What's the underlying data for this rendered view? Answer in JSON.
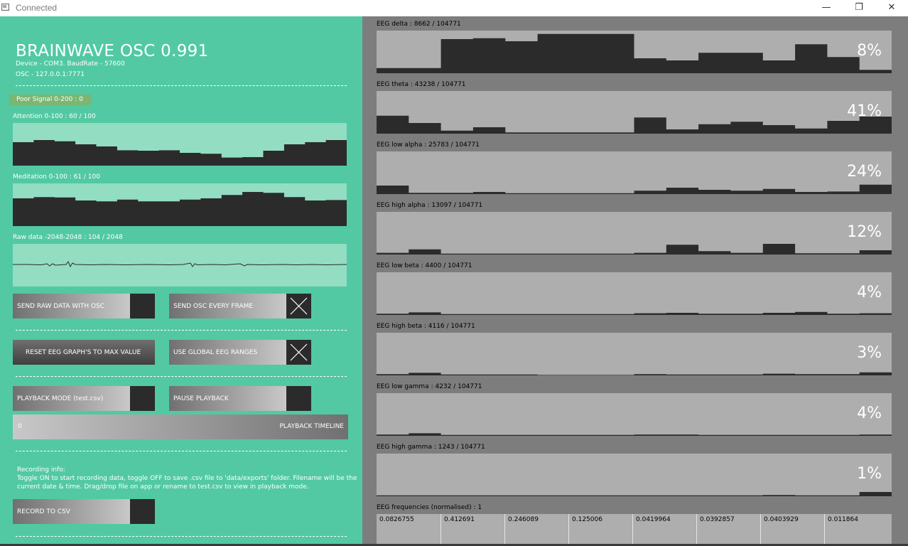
{
  "window": {
    "title": "Connected",
    "minimize": "—",
    "maximize": "❐",
    "close": "✕"
  },
  "app": {
    "title": "BRAINWAVE OSC 0.991",
    "device": "Device - COM3. BaudRate - 57600",
    "osc": "OSC - 127.0.0.1:7771"
  },
  "signal": "Poor Signal 0-200 : 0",
  "graphs": [
    {
      "label": "Attention 0-100 : 60 / 100",
      "values": [
        55,
        60,
        57,
        50,
        45,
        36,
        35,
        36,
        30,
        28,
        19,
        20,
        35,
        50,
        55,
        60
      ]
    },
    {
      "label": "Meditation 0-100 : 61 / 100",
      "values": [
        65,
        68,
        67,
        60,
        58,
        62,
        58,
        58,
        62,
        65,
        73,
        80,
        78,
        68,
        60,
        61
      ]
    },
    {
      "label": "Raw data -2048-2048 : 104 / 2048"
    }
  ],
  "buttons": {
    "send_raw": "SEND RAW DATA WITH OSC",
    "send_every_frame": "SEND OSC EVERY FRAME",
    "reset_eeg": "RESET EEG GRAPH'S TO MAX VALUE",
    "global_ranges": "USE GLOBAL EEG RANGES",
    "playback_mode": "PLAYBACK MODE (test.csv)",
    "pause_playback": "PAUSE PLAYBACK",
    "record_csv": "RECORD TO CSV"
  },
  "toggles": {
    "send_raw": false,
    "send_every_frame": true,
    "global_ranges": true,
    "playback_mode": false,
    "pause_playback": false,
    "record_csv": false
  },
  "timeline": {
    "value": "0",
    "label": "PLAYBACK TIMELINE"
  },
  "recording": {
    "title": "Recording info:",
    "line1": "Toggle ON to start recording data, toggle OFF to save .csv file to 'data/exports' folder. Filename will be the",
    "line2": "current date & time. Drag/drop file on app or rename to test.csv to view in playback mode."
  },
  "eeg": [
    {
      "label": "EEG delta : 8662 / 104771",
      "percent": "8%",
      "values": [
        12,
        12,
        80,
        82,
        75,
        92,
        92,
        92,
        35,
        30,
        48,
        48,
        30,
        68,
        38,
        8
      ]
    },
    {
      "label": "EEG theta : 43238 / 104771",
      "percent": "41%",
      "values": [
        42,
        25,
        7,
        15,
        3,
        3,
        3,
        3,
        38,
        10,
        22,
        28,
        20,
        12,
        30,
        40
      ]
    },
    {
      "label": "EEG low alpha : 25783 / 104771",
      "percent": "24%",
      "values": [
        20,
        3,
        3,
        5,
        2,
        2,
        2,
        2,
        8,
        15,
        10,
        8,
        12,
        5,
        6,
        22
      ]
    },
    {
      "label": "EEG high alpha : 13097 / 104771",
      "percent": "12%",
      "values": [
        4,
        12,
        2,
        2,
        2,
        2,
        2,
        2,
        4,
        23,
        8,
        4,
        25,
        3,
        3,
        10
      ]
    },
    {
      "label": "EEG low beta : 4400 / 104771",
      "percent": "4%",
      "values": [
        3,
        6,
        2,
        2,
        2,
        2,
        2,
        2,
        4,
        5,
        3,
        3,
        5,
        7,
        3,
        4
      ]
    },
    {
      "label": "EEG high beta : 4116 / 104771",
      "percent": "3%",
      "values": [
        3,
        6,
        2,
        2,
        2,
        1,
        1,
        1,
        3,
        2,
        2,
        2,
        4,
        3,
        3,
        7
      ]
    },
    {
      "label": "EEG low gamma : 4232 / 104771",
      "percent": "4%",
      "values": [
        3,
        6,
        2,
        2,
        2,
        2,
        2,
        2,
        3,
        3,
        2,
        2,
        2,
        2,
        2,
        3
      ]
    },
    {
      "label": "EEG high gamma : 1243 / 104771",
      "percent": "1%",
      "values": [
        2,
        2,
        2,
        2,
        2,
        2,
        2,
        2,
        2,
        2,
        2,
        2,
        3,
        2,
        2,
        10
      ]
    }
  ],
  "frequencies": {
    "label": "EEG frequencies (normalised) : 1",
    "values": [
      "0.0826755",
      "0.412691",
      "0.246089",
      "0.125006",
      "0.0419964",
      "0.0392857",
      "0.0403929",
      "0.011864"
    ]
  }
}
